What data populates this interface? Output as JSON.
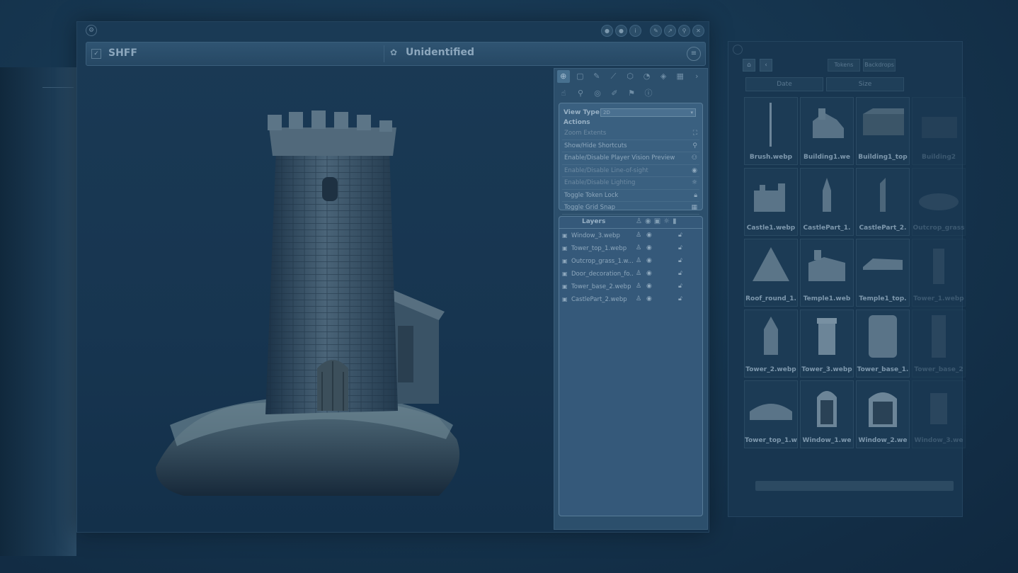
{
  "name_bar": {
    "name": "SHFF",
    "status": "Unidentified"
  },
  "view_type": {
    "label": "View Type",
    "value": "2D"
  },
  "actions": {
    "heading": "Actions",
    "items": [
      {
        "label": "Zoom Extents",
        "icon": "zoom-extents-icon",
        "dim": true
      },
      {
        "label": "Show/Hide Shortcuts",
        "icon": "pin-icon",
        "dim": false
      },
      {
        "label": "Enable/Disable Player Vision Preview",
        "icon": "player-vision-icon",
        "dim": false
      },
      {
        "label": "Enable/Disable Line-of-sight",
        "icon": "eye-icon",
        "dim": true
      },
      {
        "label": "Enable/Disable Lighting",
        "icon": "light-icon",
        "dim": true
      },
      {
        "label": "Toggle Token Lock",
        "icon": "lock-icon",
        "dim": false
      },
      {
        "label": "Toggle Grid Snap",
        "icon": "grid-icon",
        "dim": false
      }
    ]
  },
  "layers": {
    "heading": "Layers",
    "items": [
      {
        "name": "Window_3.webp"
      },
      {
        "name": "Tower_top_1.webp"
      },
      {
        "name": "Outcrop_grass_1.w..."
      },
      {
        "name": "Door_decoration_fo..."
      },
      {
        "name": "Tower_base_2.webp"
      },
      {
        "name": "CastlePart_2.webp"
      }
    ]
  },
  "assets": {
    "tabs": [
      "Tokens",
      "Backdrops"
    ],
    "sort": [
      "Date",
      "Size"
    ],
    "items": [
      {
        "name": "Brush.webp"
      },
      {
        "name": "Building1.we"
      },
      {
        "name": "Building1_top"
      },
      {
        "name": "Building2"
      },
      {
        "name": "Castle1.webp"
      },
      {
        "name": "CastlePart_1."
      },
      {
        "name": "CastlePart_2."
      },
      {
        "name": "Outcrop_grass"
      },
      {
        "name": "Roof_round_1."
      },
      {
        "name": "Temple1.web"
      },
      {
        "name": "Temple1_top."
      },
      {
        "name": "Tower_1.webp"
      },
      {
        "name": "Tower_2.webp"
      },
      {
        "name": "Tower_3.webp"
      },
      {
        "name": "Tower_base_1."
      },
      {
        "name": "Tower_base_2"
      },
      {
        "name": "Tower_top_1.w"
      },
      {
        "name": "Window_1.we"
      },
      {
        "name": "Window_2.we"
      },
      {
        "name": "Window_3.we"
      }
    ]
  }
}
